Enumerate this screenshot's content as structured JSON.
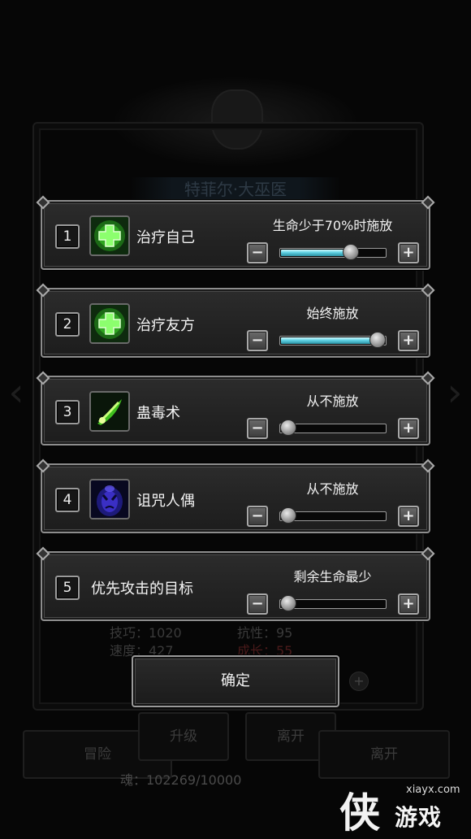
{
  "background": {
    "hero_title": "特菲尔·大巫医",
    "stats_left": [
      "技巧：1020",
      "速度：427"
    ],
    "stats_right": [
      "抗性：95",
      "成长：55"
    ],
    "buttons": [
      "冒险",
      "升级",
      "离开",
      "离开"
    ],
    "soul": "魂：102269/10000"
  },
  "skills": [
    {
      "index": "1",
      "name": "治疗自己",
      "icon": "green-cross-icon",
      "condition": "生命少于70%时施放",
      "slider_fraction": 0.7
    },
    {
      "index": "2",
      "name": "治疗友方",
      "icon": "green-cross-icon",
      "condition": "始终施放",
      "slider_fraction": 1.0
    },
    {
      "index": "3",
      "name": "蛊毒术",
      "icon": "poison-swirl-icon",
      "condition": "从不施放",
      "slider_fraction": 0.0
    },
    {
      "index": "4",
      "name": "诅咒人偶",
      "icon": "curse-doll-icon",
      "condition": "从不施放",
      "slider_fraction": 0.0
    },
    {
      "index": "5",
      "name": "优先攻击的目标",
      "icon": "",
      "condition": "剩余生命最少",
      "slider_fraction": 0.0
    }
  ],
  "confirm_label": "确定",
  "watermark": {
    "logo": "侠",
    "url": "xiayx.com",
    "text": "游戏"
  },
  "colors": {
    "slider_fill": "#5fd2e4",
    "row_border": "#8d8d8d",
    "heal_green": "#3cd42a"
  }
}
